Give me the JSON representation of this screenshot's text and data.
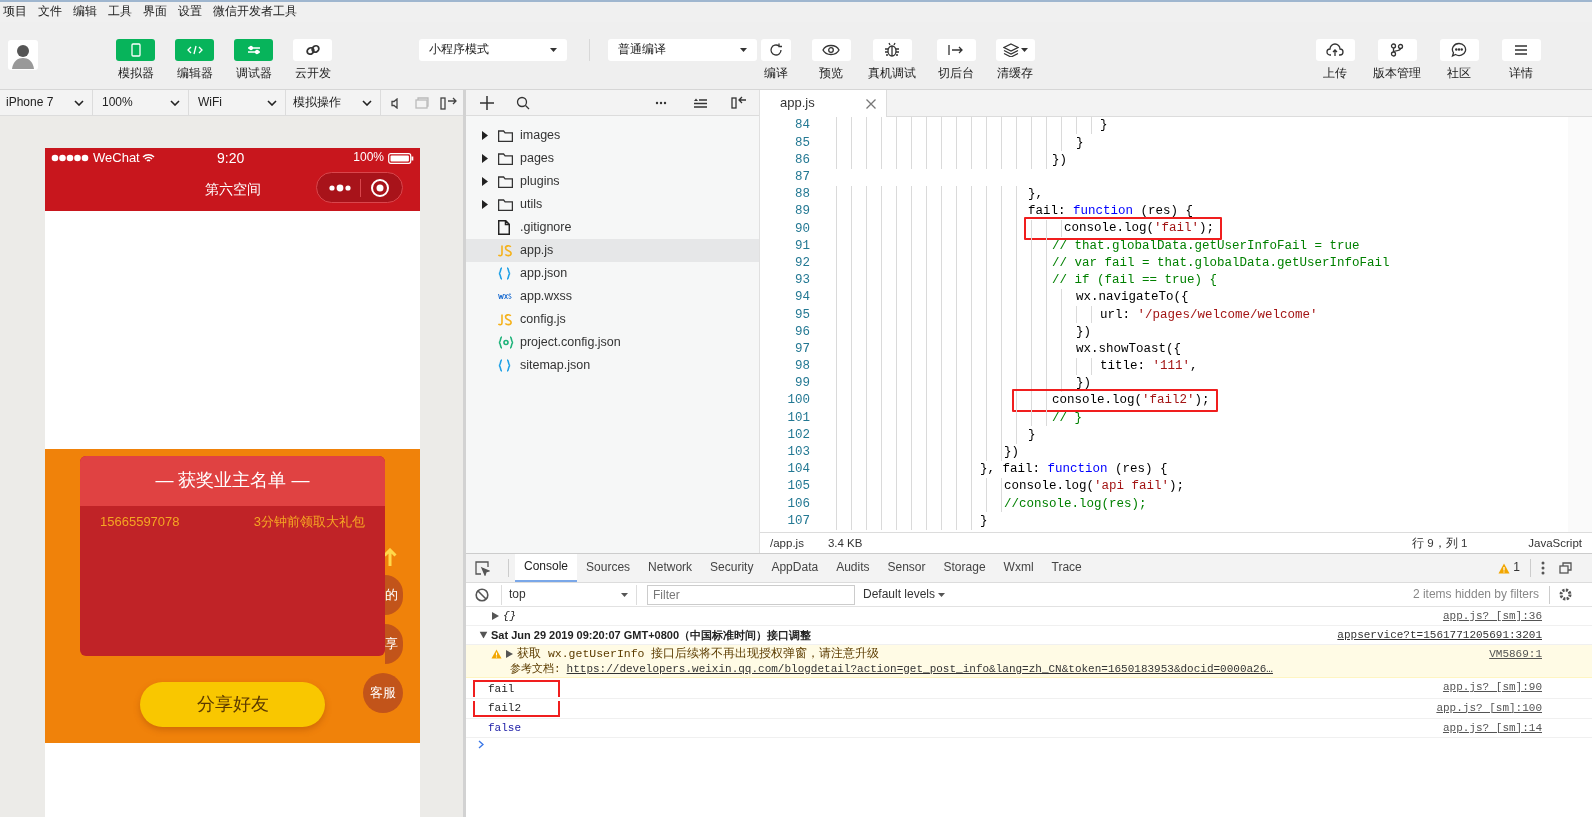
{
  "menu": [
    "项目",
    "文件",
    "编辑",
    "工具",
    "界面",
    "设置",
    "微信开发者工具"
  ],
  "toolbar": {
    "left_tools": [
      {
        "label": "模拟器",
        "active": true
      },
      {
        "label": "编辑器",
        "active": true
      },
      {
        "label": "调试器",
        "active": true
      },
      {
        "label": "云开发",
        "active": false
      }
    ],
    "mode_select": {
      "value": "小程序模式"
    },
    "compile_select": {
      "value": "普通编译"
    },
    "center_tools": [
      {
        "label": "编译",
        "has_menu": false
      },
      {
        "label": "预览",
        "has_menu": false
      },
      {
        "label": "真机调试",
        "has_menu": false
      },
      {
        "label": "切后台",
        "has_menu": false
      },
      {
        "label": "清缓存",
        "has_menu": true
      }
    ],
    "right_tools": [
      {
        "label": "上传"
      },
      {
        "label": "版本管理"
      },
      {
        "label": "社区"
      },
      {
        "label": "详情"
      }
    ]
  },
  "simulator": {
    "device_bar": [
      "iPhone 7",
      "100%",
      "WiFi",
      "模拟操作"
    ],
    "phone": {
      "carrier": "WeChat",
      "time": "9:20",
      "battery": "100%",
      "title": "第六空间",
      "winners_title": "— 获奖业主名单 —",
      "winners": [
        {
          "phone": "15665597078",
          "note": "3分钟前领取大礼包"
        }
      ],
      "side_buttons": [
        "的",
        "享",
        "客服"
      ],
      "share_button": "分享好友"
    }
  },
  "file_tree": {
    "items": [
      {
        "kind": "folder",
        "name": "images",
        "expanded": false,
        "selected": false
      },
      {
        "kind": "folder",
        "name": "pages",
        "expanded": false,
        "selected": false
      },
      {
        "kind": "folder",
        "name": "plugins",
        "expanded": false,
        "selected": false
      },
      {
        "kind": "folder",
        "name": "utils",
        "expanded": false,
        "selected": false
      },
      {
        "kind": "plain",
        "name": ".gitignore",
        "selected": false
      },
      {
        "kind": "js",
        "name": "app.js",
        "selected": true
      },
      {
        "kind": "json",
        "name": "app.json",
        "selected": false
      },
      {
        "kind": "wxss",
        "name": "app.wxss",
        "selected": false
      },
      {
        "kind": "js",
        "name": "config.js",
        "selected": false
      },
      {
        "kind": "config",
        "name": "project.config.json",
        "selected": false
      },
      {
        "kind": "json",
        "name": "sitemap.json",
        "selected": false
      }
    ]
  },
  "editor": {
    "tabs": [
      {
        "label": "app.js",
        "selected": true
      }
    ],
    "lines": [
      {
        "number": "84",
        "boxed": false,
        "tokens": [
          {
            "kind": "plain",
            "text": "                      }"
          }
        ]
      },
      {
        "number": "85",
        "boxed": false,
        "tokens": [
          {
            "kind": "plain",
            "text": "                    }"
          }
        ]
      },
      {
        "number": "86",
        "boxed": false,
        "tokens": [
          {
            "kind": "plain",
            "text": "                  })"
          }
        ]
      },
      {
        "number": "87"
      },
      {
        "number": "88",
        "boxed": false,
        "tokens": [
          {
            "kind": "plain",
            "text": "                },"
          }
        ]
      },
      {
        "number": "89",
        "boxed": false,
        "tokens": [
          {
            "kind": "plain",
            "text": "                fail: "
          },
          {
            "kind": "keyword",
            "text": "function"
          },
          {
            "kind": "plain",
            "text": " (res) {"
          }
        ]
      },
      {
        "number": "90",
        "boxed": true,
        "tokens": [
          {
            "kind": "plain",
            "text": "                   console.log("
          },
          {
            "kind": "string",
            "text": "'fail'"
          },
          {
            "kind": "plain",
            "text": ");"
          }
        ]
      },
      {
        "number": "91",
        "boxed": false,
        "tokens": [
          {
            "kind": "comment",
            "text": "                  // that.globalData.getUserInfoFail = true"
          }
        ]
      },
      {
        "number": "92",
        "boxed": false,
        "tokens": [
          {
            "kind": "comment",
            "text": "                  // var fail = that.globalData.getUserInfoFail"
          }
        ]
      },
      {
        "number": "93",
        "boxed": false,
        "tokens": [
          {
            "kind": "comment",
            "text": "                  // if (fail == true) {"
          }
        ]
      },
      {
        "number": "94",
        "boxed": false,
        "tokens": [
          {
            "kind": "plain",
            "text": "                    wx.navigateTo({"
          }
        ]
      },
      {
        "number": "95",
        "boxed": false,
        "tokens": [
          {
            "kind": "plain",
            "text": "                      url: "
          },
          {
            "kind": "string",
            "text": "'/pages/welcome/welcome'"
          }
        ]
      },
      {
        "number": "96",
        "boxed": false,
        "tokens": [
          {
            "kind": "plain",
            "text": "                    })"
          }
        ]
      },
      {
        "number": "97",
        "boxed": false,
        "tokens": [
          {
            "kind": "plain",
            "text": "                    wx.showToast({"
          }
        ]
      },
      {
        "number": "98",
        "boxed": false,
        "tokens": [
          {
            "kind": "plain",
            "text": "                      title: "
          },
          {
            "kind": "string",
            "text": "'111'"
          },
          {
            "kind": "plain",
            "text": ","
          }
        ]
      },
      {
        "number": "99",
        "boxed": false,
        "tokens": [
          {
            "kind": "plain",
            "text": "                    })"
          }
        ]
      },
      {
        "number": "100",
        "boxed": true,
        "tokens": [
          {
            "kind": "plain",
            "text": "                  console.log("
          },
          {
            "kind": "string",
            "text": "'fail2'"
          },
          {
            "kind": "plain",
            "text": ");"
          }
        ]
      },
      {
        "number": "101",
        "boxed": false,
        "tokens": [
          {
            "kind": "comment",
            "text": "                  // }"
          }
        ]
      },
      {
        "number": "102",
        "boxed": false,
        "tokens": [
          {
            "kind": "plain",
            "text": "                }"
          }
        ]
      },
      {
        "number": "103",
        "boxed": false,
        "tokens": [
          {
            "kind": "plain",
            "text": "              })"
          }
        ]
      },
      {
        "number": "104",
        "boxed": false,
        "tokens": [
          {
            "kind": "plain",
            "text": "            }, fail: "
          },
          {
            "kind": "keyword",
            "text": "function"
          },
          {
            "kind": "plain",
            "text": " (res) {"
          }
        ]
      },
      {
        "number": "105",
        "boxed": false,
        "tokens": [
          {
            "kind": "plain",
            "text": "              console.log("
          },
          {
            "kind": "string",
            "text": "'api fail'"
          },
          {
            "kind": "plain",
            "text": ");"
          }
        ]
      },
      {
        "number": "106",
        "boxed": false,
        "tokens": [
          {
            "kind": "comment",
            "text": "              //console.log(res);"
          }
        ]
      },
      {
        "number": "107",
        "boxed": false,
        "tokens": [
          {
            "kind": "plain",
            "text": "            }"
          }
        ]
      }
    ],
    "status": {
      "path": "/app.js",
      "size": "3.4 KB",
      "position": "行 9，列 1",
      "language": "JavaScript"
    }
  },
  "console": {
    "tabs": [
      {
        "label": "Console",
        "selected": true
      },
      {
        "label": "Sources",
        "selected": false
      },
      {
        "label": "Network",
        "selected": false
      },
      {
        "label": "Security",
        "selected": false
      },
      {
        "label": "AppData",
        "selected": false
      },
      {
        "label": "Audits",
        "selected": false
      },
      {
        "label": "Sensor",
        "selected": false
      },
      {
        "label": "Storage",
        "selected": false
      },
      {
        "label": "Wxml",
        "selected": false
      },
      {
        "label": "Trace",
        "selected": false
      }
    ],
    "warning_count": "1",
    "context": "top",
    "filter_placeholder": "Filter",
    "levels": "Default levels",
    "hidden_note": "2 items hidden by filters",
    "entries": [
      {
        "kind": "object",
        "expanded": false,
        "text": "{}",
        "source": "app.js? [sm]:36"
      },
      {
        "kind": "group",
        "expanded": true,
        "text": "Sat Jun 29 2019 09:20:07 GMT+0800（中国标准时间）接口调整",
        "source": "appservice?t=1561771205691:3201"
      },
      {
        "kind": "warning",
        "expanded": false,
        "text": "获取 wx.getUserInfo 接口后续将不再出现授权弹窗，请注意升级",
        "doc_label": "参考文档:",
        "link": "https://developers.weixin.qq.com/blogdetail?action=get_post_info&lang=zh_CN&token=1650183953&docid=0000a26…",
        "source": "VM5869:1"
      },
      {
        "kind": "log",
        "boxed": true,
        "text": "fail",
        "source": "app.js? [sm]:90"
      },
      {
        "kind": "log",
        "boxed": true,
        "text": "fail2",
        "source": "app.js? [sm]:100"
      },
      {
        "kind": "value",
        "boxed": false,
        "text": "false",
        "source": "app.js? [sm]:14"
      }
    ]
  }
}
